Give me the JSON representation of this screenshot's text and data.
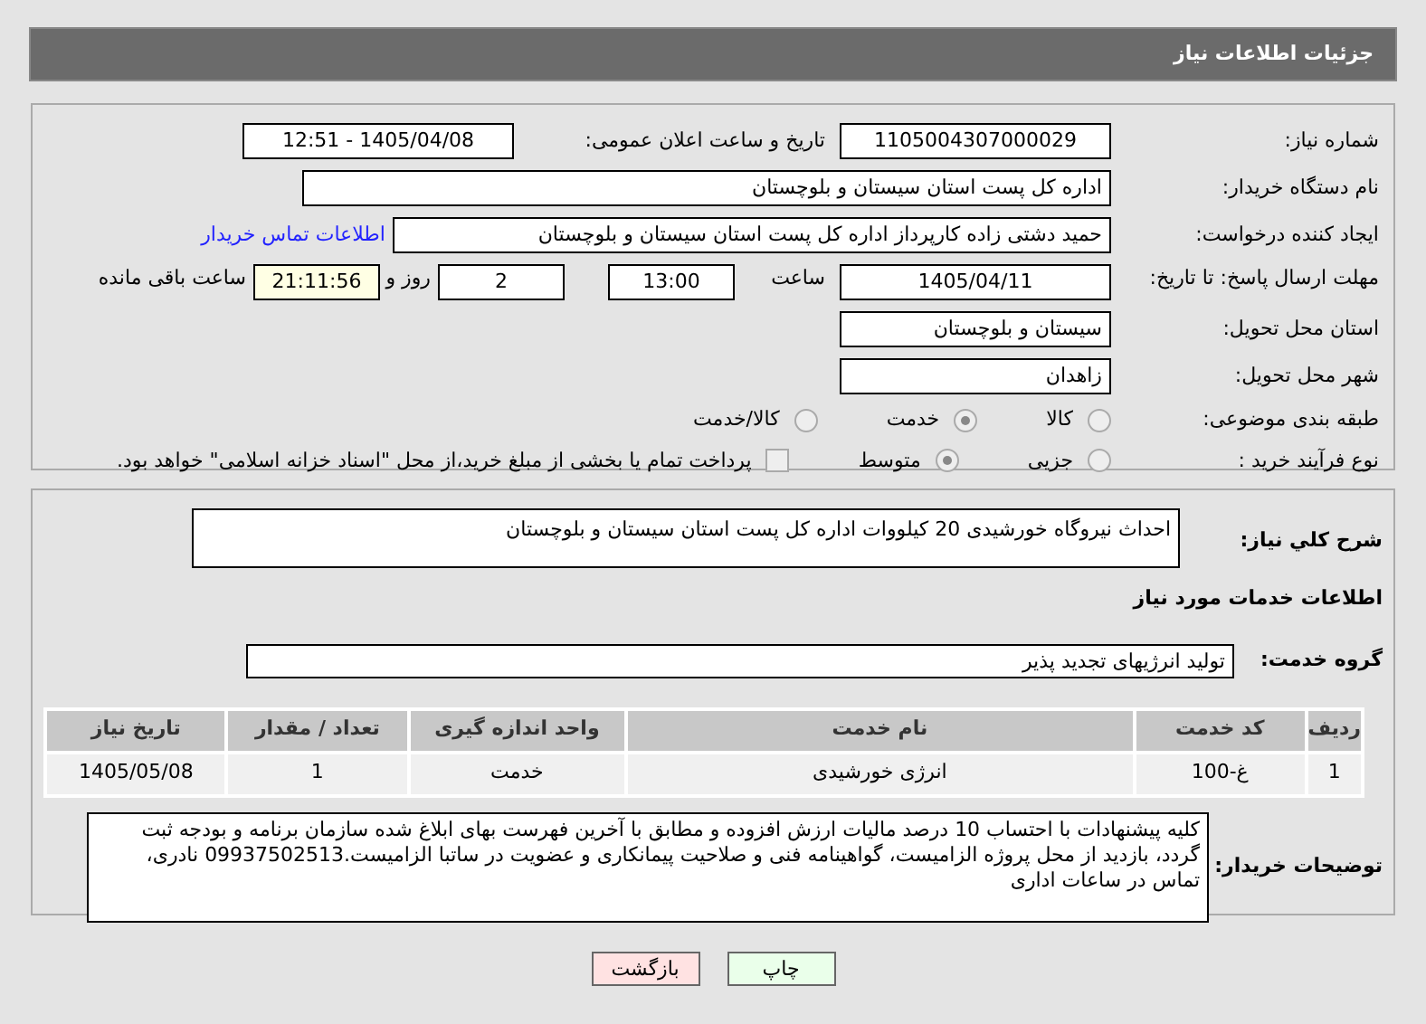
{
  "header": {
    "title": "جزئیات اطلاعات نیاز"
  },
  "need_number": {
    "label": "شماره نیاز:",
    "value": "1105004307000029"
  },
  "announce": {
    "label": "تاریخ و ساعت اعلان عمومی:",
    "value": "1405/04/08 - 12:51"
  },
  "buyer": {
    "label": "نام دستگاه خریدار:",
    "value": "اداره کل پست استان سیستان و بلوچستان"
  },
  "requester": {
    "label": "ایجاد کننده درخواست:",
    "value": "حمید دشتی زاده کارپرداز اداره کل پست استان سیستان و بلوچستان",
    "link": "اطلاعات تماس خریدار"
  },
  "deadline": {
    "label": "مهلت ارسال پاسخ: تا تاریخ:",
    "date": "1405/04/11",
    "time_label": "ساعت",
    "time": "13:00",
    "days": "2",
    "days_label": "روز و",
    "remaining": "21:11:56",
    "remaining_label": "ساعت باقی مانده"
  },
  "province": {
    "label": "استان محل تحویل:",
    "value": "سیستان و بلوچستان"
  },
  "city": {
    "label": "شهر محل تحویل:",
    "value": "زاهدان"
  },
  "category": {
    "label": "طبقه بندی موضوعی:",
    "options": [
      {
        "label": "کالا",
        "selected": false
      },
      {
        "label": "خدمت",
        "selected": true
      },
      {
        "label": "کالا/خدمت",
        "selected": false
      }
    ]
  },
  "process": {
    "label": "نوع فرآیند خرید :",
    "options": [
      {
        "label": "جزیی",
        "selected": false
      },
      {
        "label": "متوسط",
        "selected": true
      }
    ],
    "payment": {
      "label": "پرداخت تمام یا بخشی از مبلغ خرید،از محل \"اسناد خزانه اسلامی\" خواهد بود.",
      "checked": false
    }
  },
  "description": {
    "label": "شرح کلي نياز:",
    "value": "احداث نیروگاه خورشیدی 20 کیلووات اداره کل پست استان سیستان و بلوچستان"
  },
  "services_title": "اطلاعات خدمات مورد نیاز",
  "service_group": {
    "label": "گروه خدمت:",
    "value": "تولید انرژیهای تجدید پذیر"
  },
  "table": {
    "columns": [
      "ردیف",
      "کد خدمت",
      "نام خدمت",
      "واحد اندازه گیری",
      "تعداد / مقدار",
      "تاریخ نیاز"
    ],
    "rows": [
      [
        "1",
        "غ-100",
        "انرژی خورشیدی",
        "خدمت",
        "1",
        "1405/05/08"
      ]
    ]
  },
  "notes": {
    "label": "توضیحات خریدار:",
    "value": "کلیه پیشنهادات با احتساب 10 درصد مالیات ارزش افزوده و مطابق با آخرین فهرست بهای ابلاغ شده سازمان برنامه و بودجه ثبت گردد، بازدید از محل پروژه الزامیست، گواهینامه فنی و صلاحیت پیمانکاری و عضویت در ساتبا الزامیست.09937502513 نادری، تماس در ساعات اداری"
  },
  "buttons": [
    {
      "label": "چاپ",
      "kind": "print"
    },
    {
      "label": "بازگشت",
      "kind": "back"
    }
  ]
}
